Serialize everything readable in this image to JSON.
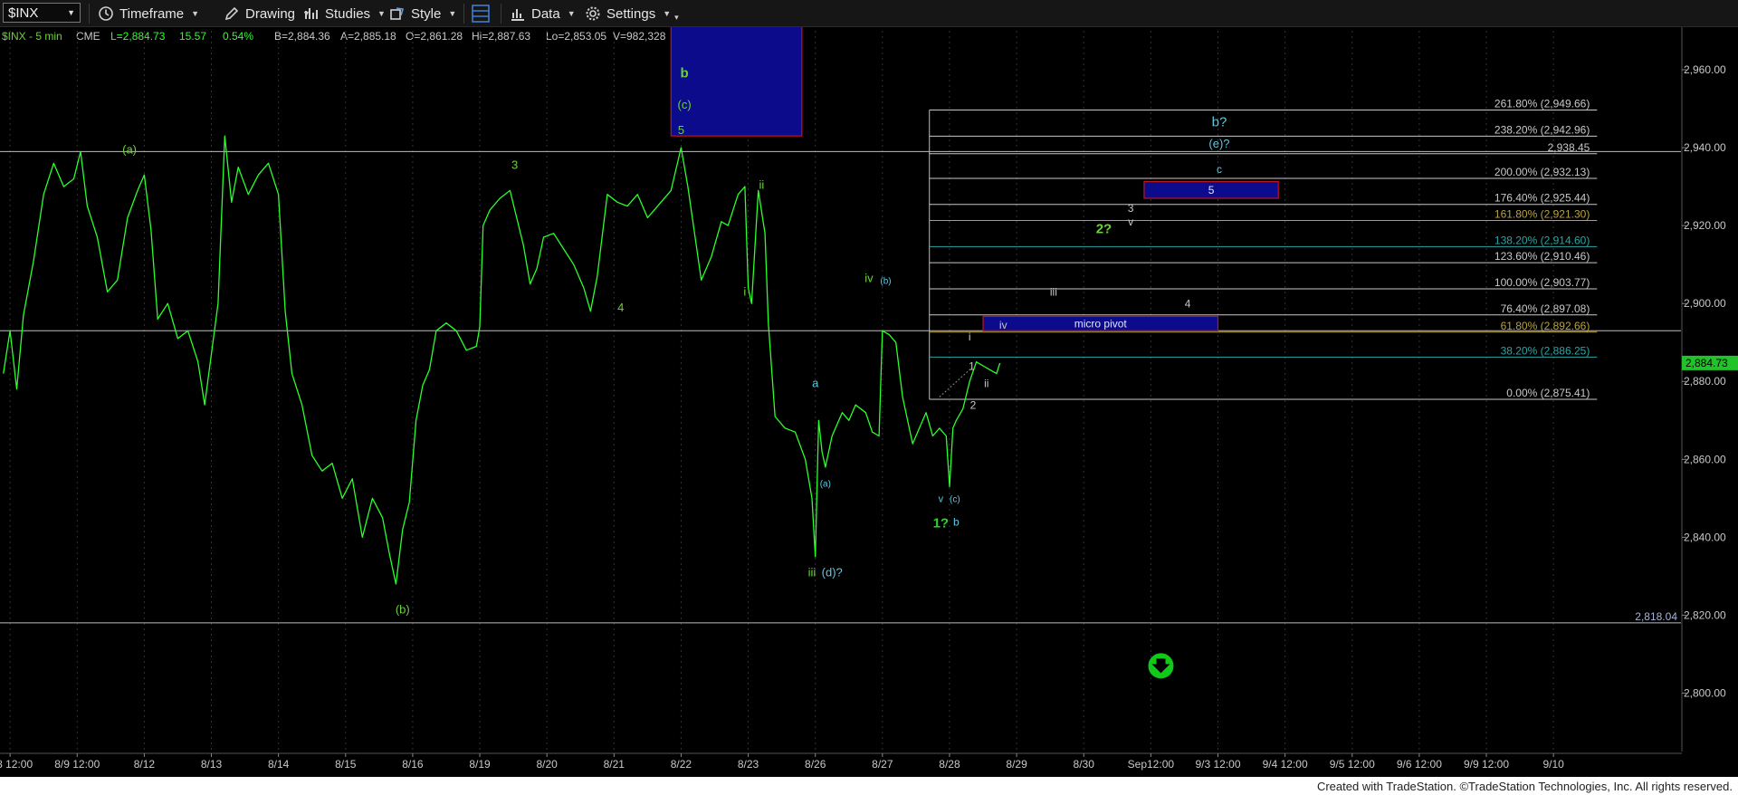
{
  "toolbar": {
    "symbol": "$INX",
    "timeframe": "Timeframe",
    "drawing": "Drawing",
    "studies": "Studies",
    "style": "Style",
    "data": "Data",
    "settings": "Settings"
  },
  "colors": {
    "price": "#2bff2b",
    "wave_green": "#6bd23a",
    "wave_cyan": "#5fc8e0",
    "wave_white": "#c8c8c8",
    "box_fill": "#0b0b8c",
    "box_border": "#c0141e",
    "grid": "#2a2a2a",
    "axis_text": "#c8c8c8"
  },
  "footer": {
    "credit": "Created with TradeStation. ©TradeStation Technologies, Inc. All rights reserved."
  },
  "chart_data": {
    "type": "line",
    "header": {
      "symbol": "$INX - 5 min",
      "exchange": "CME",
      "last": "L=2,884.73",
      "change": "15.57",
      "change_pct": "0.54%",
      "bid": "B=2,884.36",
      "ask": "A=2,885.18",
      "open": "O=2,861.28",
      "high": "Hi=2,887.63",
      "low": "Lo=2,853.05",
      "volume": "V=982,328"
    },
    "ylim": [
      2785,
      2970
    ],
    "yticks": [
      "2,960.00",
      "2,940.00",
      "2,920.00",
      "2,900.00",
      "2,880.00",
      "2,860.00",
      "2,840.00",
      "2,820.00",
      "2,800.00"
    ],
    "ytick_values": [
      2960,
      2940,
      2920,
      2900,
      2880,
      2860,
      2840,
      2820,
      2800
    ],
    "last_price_label": "2,884.73",
    "last_price": 2884.73,
    "xlim": [
      -0.15,
      24.9
    ],
    "x_labels": [
      {
        "x": 0,
        "label": "8/8 12:00"
      },
      {
        "x": 1,
        "label": "8/9 12:00"
      },
      {
        "x": 2,
        "label": "8/12"
      },
      {
        "x": 3,
        "label": "8/13"
      },
      {
        "x": 4,
        "label": "8/14"
      },
      {
        "x": 5,
        "label": "8/15"
      },
      {
        "x": 6,
        "label": "8/16"
      },
      {
        "x": 7,
        "label": "8/19"
      },
      {
        "x": 8,
        "label": "8/20"
      },
      {
        "x": 9,
        "label": "8/21"
      },
      {
        "x": 10,
        "label": "8/22"
      },
      {
        "x": 11,
        "label": "8/23"
      },
      {
        "x": 12,
        "label": "8/26"
      },
      {
        "x": 13,
        "label": "8/27"
      },
      {
        "x": 14,
        "label": "8/28"
      },
      {
        "x": 15,
        "label": "8/29"
      },
      {
        "x": 16,
        "label": "8/30"
      },
      {
        "x": 17,
        "label": "Sep12:00"
      },
      {
        "x": 18,
        "label": "9/3 12:00"
      },
      {
        "x": 19,
        "label": "9/4 12:00"
      },
      {
        "x": 20,
        "label": "9/5 12:00"
      },
      {
        "x": 21,
        "label": "9/6 12:00"
      },
      {
        "x": 22,
        "label": "9/9 12:00"
      },
      {
        "x": 23,
        "label": "9/10"
      }
    ],
    "series": [
      {
        "points": [
          [
            -0.1,
            2882
          ],
          [
            0.0,
            2893
          ],
          [
            0.1,
            2878
          ],
          [
            0.2,
            2897
          ],
          [
            0.35,
            2911
          ],
          [
            0.5,
            2928
          ],
          [
            0.65,
            2936
          ],
          [
            0.8,
            2930
          ],
          [
            0.95,
            2932
          ],
          [
            1.05,
            2939
          ],
          [
            1.15,
            2925
          ],
          [
            1.3,
            2917
          ],
          [
            1.45,
            2903
          ],
          [
            1.6,
            2906
          ],
          [
            1.75,
            2922
          ],
          [
            1.9,
            2929
          ],
          [
            2.0,
            2933
          ],
          [
            2.1,
            2919
          ],
          [
            2.2,
            2896
          ],
          [
            2.35,
            2900
          ],
          [
            2.5,
            2891
          ],
          [
            2.65,
            2893
          ],
          [
            2.8,
            2885
          ],
          [
            2.9,
            2874
          ],
          [
            3.0,
            2887
          ],
          [
            3.1,
            2900
          ],
          [
            3.2,
            2943
          ],
          [
            3.3,
            2926
          ],
          [
            3.4,
            2935
          ],
          [
            3.55,
            2928
          ],
          [
            3.7,
            2933
          ],
          [
            3.85,
            2936
          ],
          [
            4.0,
            2928
          ],
          [
            4.1,
            2898
          ],
          [
            4.2,
            2882
          ],
          [
            4.35,
            2874
          ],
          [
            4.5,
            2861
          ],
          [
            4.65,
            2857
          ],
          [
            4.8,
            2859
          ],
          [
            4.95,
            2850
          ],
          [
            5.1,
            2855
          ],
          [
            5.25,
            2840
          ],
          [
            5.4,
            2850
          ],
          [
            5.55,
            2845
          ],
          [
            5.65,
            2836
          ],
          [
            5.75,
            2828
          ],
          [
            5.85,
            2842
          ],
          [
            5.95,
            2849
          ],
          [
            6.05,
            2870
          ],
          [
            6.15,
            2879
          ],
          [
            6.25,
            2883
          ],
          [
            6.35,
            2893
          ],
          [
            6.5,
            2895
          ],
          [
            6.65,
            2893
          ],
          [
            6.8,
            2888
          ],
          [
            6.95,
            2889
          ],
          [
            7.0,
            2894
          ],
          [
            7.05,
            2920
          ],
          [
            7.15,
            2924
          ],
          [
            7.3,
            2927
          ],
          [
            7.45,
            2929
          ],
          [
            7.55,
            2922
          ],
          [
            7.65,
            2915
          ],
          [
            7.75,
            2905
          ],
          [
            7.85,
            2909
          ],
          [
            7.95,
            2917
          ],
          [
            8.1,
            2918
          ],
          [
            8.25,
            2914
          ],
          [
            8.4,
            2910
          ],
          [
            8.55,
            2904
          ],
          [
            8.65,
            2898
          ],
          [
            8.75,
            2907
          ],
          [
            8.9,
            2928
          ],
          [
            9.05,
            2926
          ],
          [
            9.2,
            2925
          ],
          [
            9.35,
            2928
          ],
          [
            9.5,
            2922
          ],
          [
            9.65,
            2925
          ],
          [
            9.85,
            2929
          ],
          [
            10.0,
            2940
          ],
          [
            10.1,
            2930
          ],
          [
            10.2,
            2918
          ],
          [
            10.3,
            2906
          ],
          [
            10.45,
            2912
          ],
          [
            10.6,
            2921
          ],
          [
            10.7,
            2920
          ],
          [
            10.85,
            2928
          ],
          [
            10.95,
            2930
          ],
          [
            11.0,
            2904
          ],
          [
            11.05,
            2900
          ],
          [
            11.15,
            2929
          ],
          [
            11.25,
            2918
          ],
          [
            11.3,
            2895
          ],
          [
            11.4,
            2871
          ],
          [
            11.55,
            2868
          ],
          [
            11.7,
            2867
          ],
          [
            11.85,
            2860
          ],
          [
            11.95,
            2850
          ],
          [
            12.0,
            2835
          ],
          [
            12.05,
            2870
          ],
          [
            12.1,
            2862
          ],
          [
            12.15,
            2858
          ],
          [
            12.25,
            2866
          ],
          [
            12.4,
            2872
          ],
          [
            12.5,
            2870
          ],
          [
            12.6,
            2874
          ],
          [
            12.75,
            2872
          ],
          [
            12.85,
            2867
          ],
          [
            12.95,
            2866
          ],
          [
            13.0,
            2893
          ],
          [
            13.1,
            2892
          ],
          [
            13.2,
            2890
          ],
          [
            13.3,
            2876
          ],
          [
            13.45,
            2864
          ],
          [
            13.55,
            2868
          ],
          [
            13.65,
            2872
          ],
          [
            13.75,
            2866
          ],
          [
            13.85,
            2868
          ],
          [
            13.95,
            2866
          ],
          [
            14.0,
            2853
          ],
          [
            14.05,
            2868
          ],
          [
            14.1,
            2870
          ],
          [
            14.2,
            2873
          ],
          [
            14.3,
            2880
          ],
          [
            14.4,
            2885
          ],
          [
            14.5,
            2884
          ],
          [
            14.6,
            2883
          ],
          [
            14.7,
            2882
          ],
          [
            14.75,
            2884.7
          ]
        ]
      }
    ],
    "horizontal_lines": [
      {
        "y": 2939,
        "x_from": -0.15
      },
      {
        "y": 2893,
        "x_from": -0.15
      },
      {
        "y": 2818.04,
        "x_from": -0.15,
        "label": "2,818.04"
      }
    ],
    "fib_levels": [
      {
        "y": 2949.66,
        "label": "261.80% (2,949.66)",
        "color": "#c8c8c8"
      },
      {
        "y": 2942.96,
        "label": "238.20% (2,942.96)",
        "color": "#c8c8c8"
      },
      {
        "y": 2938.45,
        "label": "2,938.45",
        "color": "#c8c8c8"
      },
      {
        "y": 2932.13,
        "label": "200.00% (2,932.13)",
        "color": "#c8c8c8"
      },
      {
        "y": 2925.44,
        "label": "176.40% (2,925.44)",
        "color": "#c8c8c8"
      },
      {
        "y": 2921.3,
        "label": "161.80% (2,921.30)",
        "color": "#b9a23c"
      },
      {
        "y": 2914.6,
        "label": "138.20% (2,914.60)",
        "color": "#2aa5a5"
      },
      {
        "y": 2910.46,
        "label": "123.60% (2,910.46)",
        "color": "#c8c8c8"
      },
      {
        "y": 2903.77,
        "label": "100.00% (2,903.77)",
        "color": "#c8c8c8"
      },
      {
        "y": 2897.08,
        "label": "76.40% (2,897.08)",
        "color": "#c8c8c8"
      },
      {
        "y": 2892.66,
        "label": "61.80% (2,892.66)",
        "color": "#b9a23c"
      },
      {
        "y": 2886.25,
        "label": "38.20% (2,886.25)",
        "color": "#2aa5a5"
      },
      {
        "y": 2875.41,
        "label": "0.00% (2,875.41)",
        "color": "#c8c8c8"
      }
    ],
    "fib_x_from": 13.7,
    "fib_x_to": 23.65,
    "boxes": [
      {
        "x1": 9.85,
        "x2": 11.8,
        "y1": 2943,
        "y2": 2972,
        "label": ""
      },
      {
        "x1": 16.9,
        "x2": 18.9,
        "y1": 2927,
        "y2": 2931.3,
        "label": "5"
      },
      {
        "x1": 14.5,
        "x2": 18.0,
        "y1": 2893,
        "y2": 2896.7,
        "label": "micro pivot"
      }
    ],
    "annotations": [
      {
        "x": 10.05,
        "y": 2958,
        "text": "b",
        "color": "#6bd23a",
        "size": 15,
        "bold": true
      },
      {
        "x": 10.05,
        "y": 2950,
        "text": "(c)",
        "color": "#6bd23a",
        "size": 13
      },
      {
        "x": 10.0,
        "y": 2943.5,
        "text": "5",
        "color": "#6bd23a",
        "size": 13
      },
      {
        "x": 1.78,
        "y": 2938.5,
        "text": "(a)",
        "color": "#6bd23a",
        "size": 13
      },
      {
        "x": 7.52,
        "y": 2934.5,
        "text": "3",
        "color": "#6bd23a",
        "size": 13
      },
      {
        "x": 11.2,
        "y": 2929.5,
        "text": "ii",
        "color": "#6bd23a",
        "size": 13
      },
      {
        "x": 9.1,
        "y": 2898,
        "text": "4",
        "color": "#6bd23a",
        "size": 13
      },
      {
        "x": 10.95,
        "y": 2902,
        "text": "i",
        "color": "#6bd23a",
        "size": 13
      },
      {
        "x": 12.8,
        "y": 2905.5,
        "text": "iv",
        "color": "#6bd23a",
        "size": 13
      },
      {
        "x": 13.05,
        "y": 2905,
        "text": "(b)",
        "color": "#5fc8e0",
        "size": 10
      },
      {
        "x": 12.0,
        "y": 2878.5,
        "text": "a",
        "color": "#5fc8e0",
        "size": 13
      },
      {
        "x": 12.15,
        "y": 2853,
        "text": "(a)",
        "color": "#5fc8e0",
        "size": 10
      },
      {
        "x": 11.95,
        "y": 2830,
        "text": "iii",
        "color": "#6bd23a",
        "size": 13
      },
      {
        "x": 12.25,
        "y": 2830,
        "text": "(d)?",
        "color": "#5fc8e0",
        "size": 13
      },
      {
        "x": 5.85,
        "y": 2820.5,
        "text": "(b)",
        "color": "#6bd23a",
        "size": 13
      },
      {
        "x": 13.87,
        "y": 2849,
        "text": "v",
        "color": "#5fc8e0",
        "size": 11
      },
      {
        "x": 14.08,
        "y": 2849,
        "text": "(c)",
        "color": "#5fc8e0",
        "size": 10
      },
      {
        "x": 13.87,
        "y": 2842.5,
        "text": "1?",
        "color": "#2bd52b",
        "size": 15,
        "bold": true
      },
      {
        "x": 14.1,
        "y": 2843,
        "text": "b",
        "color": "#5fc8e0",
        "size": 12
      },
      {
        "x": 14.33,
        "y": 2883,
        "text": "1",
        "color": "#c8c8c8",
        "size": 12
      },
      {
        "x": 14.35,
        "y": 2873,
        "text": "2",
        "color": "#c8c8c8",
        "size": 12
      },
      {
        "x": 14.55,
        "y": 2878.5,
        "text": "ii",
        "color": "#c8c8c8",
        "size": 12
      },
      {
        "x": 14.8,
        "y": 2893.5,
        "text": "iv",
        "color": "#c8c8c8",
        "size": 12
      },
      {
        "x": 14.3,
        "y": 2890.5,
        "text": "i",
        "color": "#c8c8c8",
        "size": 12
      },
      {
        "x": 15.55,
        "y": 2902,
        "text": "iii",
        "color": "#c8c8c8",
        "size": 12
      },
      {
        "x": 17.55,
        "y": 2899,
        "text": "4",
        "color": "#c8c8c8",
        "size": 12
      },
      {
        "x": 16.7,
        "y": 2923.5,
        "text": "3",
        "color": "#c8c8c8",
        "size": 12
      },
      {
        "x": 16.7,
        "y": 2920,
        "text": "v",
        "color": "#c8c8c8",
        "size": 12
      },
      {
        "x": 16.3,
        "y": 2918,
        "text": "2?",
        "color": "#6bd23a",
        "size": 15,
        "bold": true
      },
      {
        "x": 18.02,
        "y": 2945.5,
        "text": "b?",
        "color": "#5fc8e0",
        "size": 15
      },
      {
        "x": 18.02,
        "y": 2940,
        "text": "(e)?",
        "color": "#5fc8e0",
        "size": 13
      },
      {
        "x": 18.02,
        "y": 2933.5,
        "text": "c",
        "color": "#5fc8e0",
        "size": 12
      }
    ],
    "down_arrow": {
      "x": 17.15,
      "y": 2807
    }
  }
}
